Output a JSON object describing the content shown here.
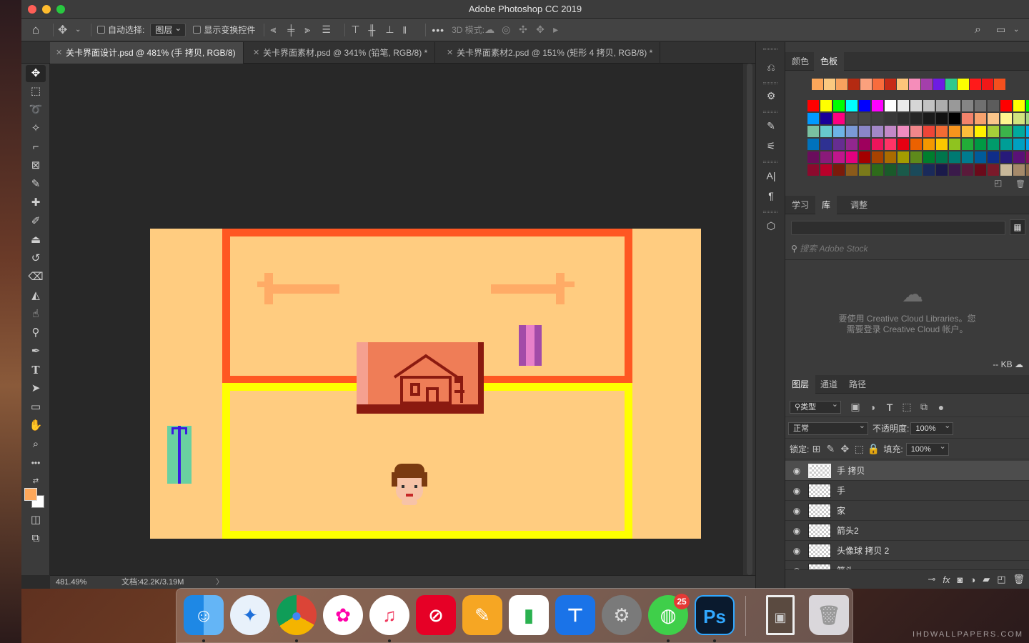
{
  "app": {
    "title": "Adobe Photoshop CC 2019"
  },
  "options_bar": {
    "auto_select_label": "自动选择:",
    "auto_select_value": "图层",
    "show_transform_label": "显示变换控件",
    "more": "•••",
    "mode_3d_label": "3D 模式:"
  },
  "tabs": [
    {
      "label": "关卡界面设计.psd @ 481% (手 拷贝, RGB/8)",
      "active": true
    },
    {
      "label": "关卡界面素材.psd @ 341% (铅笔, RGB/8) *",
      "active": false
    },
    {
      "label": "关卡界面素材2.psd @ 151% (矩形 4 拷贝, RGB/8) *",
      "active": false
    }
  ],
  "status": {
    "zoom": "481.49%",
    "doc": "文档:42.2K/3.19M"
  },
  "colors": {
    "foreground": "#fda75a",
    "background": "#ffffff",
    "artboard": "#ffcc80",
    "top_frame": "#ff5722",
    "bottom_frame": "#ffff00",
    "house_panel": "#ef7d57",
    "house_dark": "#8b1a10"
  },
  "swatch_panel": {
    "tab_color": "颜色",
    "tab_swatches": "色板",
    "recent": [
      "#fda75a",
      "#fbc980",
      "#f8a25e",
      "#b42a12",
      "#fba17d",
      "#f96c3c",
      "#c62b17",
      "#fdc57a",
      "#f58dba",
      "#a43fab",
      "#6e1be3",
      "#2ec98b",
      "#fbff00",
      "#ff1a1a",
      "#f01818",
      "#f4501e"
    ],
    "rows": [
      [
        "#ff0000",
        "#ffff00",
        "#00ff00",
        "#00ffff",
        "#0000ff",
        "#ff00ff",
        "#ffffff",
        "#ebebeb",
        "#d6d6d6",
        "#c2c2c2",
        "#adadad",
        "#999999",
        "#858585",
        "#707070",
        "#5c5c5c",
        "#ff0000",
        "#ffff00",
        "#00ff00"
      ],
      [
        "#0099ff",
        "#1a0099",
        "#ff0080",
        "#4d4d4d",
        "#474747",
        "#404040",
        "#383838",
        "#2e2e2e",
        "#262626",
        "#1a1a1a",
        "#111111",
        "#000000",
        "#f2836b",
        "#f7a26d",
        "#fbc58a",
        "#fff68f",
        "#d1e37e",
        "#a3d67f"
      ],
      [
        "#7ac0a0",
        "#67c9cc",
        "#6db4e6",
        "#7a9ad6",
        "#8a86c8",
        "#a387c7",
        "#c388c7",
        "#f08cc0",
        "#f2868a",
        "#ee4538",
        "#f26b34",
        "#f7941d",
        "#fdbd3b",
        "#fff200",
        "#a6ce39",
        "#3cb44a",
        "#00a99d",
        "#00aeef"
      ],
      [
        "#0072bc",
        "#2e3192",
        "#662d91",
        "#92278f",
        "#9e005d",
        "#ed145b",
        "#ff3366",
        "#e60012",
        "#eb6100",
        "#f39800",
        "#fcc800",
        "#8fc31f",
        "#22ac38",
        "#009944",
        "#009b6b",
        "#009e96",
        "#00a0c1",
        "#00a0e9"
      ],
      [
        "#6a0d5c",
        "#8a1a7a",
        "#c0168c",
        "#e4007f",
        "#a40000",
        "#a84200",
        "#aa6b00",
        "#a39c00",
        "#5e8a1b",
        "#007e2e",
        "#00764c",
        "#007a72",
        "#007b8f",
        "#005b9a",
        "#0f2d8a",
        "#271a7a",
        "#5a1177",
        "#84115f"
      ],
      [
        "#8b0a2d",
        "#b8002a",
        "#7a1a0a",
        "#8a5a1a",
        "#7a7a1a",
        "#2e6b1a",
        "#1a5a2a",
        "#1a5a4a",
        "#1a4a5a",
        "#1a2a5a",
        "#1a1a4a",
        "#3a1a4a",
        "#5a1a3a",
        "#6a0a1a",
        "#7a1a2a",
        "#c8b89a",
        "#a68a6a",
        "#8a6a4a"
      ]
    ]
  },
  "library_panel": {
    "tab_learn": "学习",
    "tab_library": "库",
    "tab_adjust": "调整",
    "search_placeholder": "搜索 Adobe Stock",
    "message_line1": "要使用 Creative Cloud Libraries。您",
    "message_line2": "需要登录 Creative Cloud 帐户。",
    "kb": "-- KB"
  },
  "layers_panel": {
    "tab_layers": "图层",
    "tab_channels": "通道",
    "tab_paths": "路径",
    "filter_label": "类型",
    "blend_mode": "正常",
    "opacity_label": "不透明度:",
    "opacity": "100%",
    "lock_label": "锁定:",
    "fill_label": "填充:",
    "fill": "100%",
    "layers": [
      {
        "name": "手 拷贝",
        "selected": true
      },
      {
        "name": "手",
        "selected": false
      },
      {
        "name": "家",
        "selected": false
      },
      {
        "name": "箭头2",
        "selected": false
      },
      {
        "name": "头像球 拷贝 2",
        "selected": false
      },
      {
        "name": "箭头",
        "selected": false
      }
    ]
  },
  "dock": {
    "apps": [
      "finder-icon",
      "safari-icon",
      "chrome-icon",
      "photos-icon",
      "itunes-icon",
      "netease-music-icon",
      "pages-icon",
      "numbers-icon",
      "keynote-icon",
      "system-preferences-icon",
      "wechat-icon",
      "photoshop-icon",
      "image-file-icon",
      "trash-icon"
    ],
    "wechat_badge": "25",
    "photoshop_label": "Ps"
  },
  "watermark": "IHDWALLPAPERS.COM"
}
